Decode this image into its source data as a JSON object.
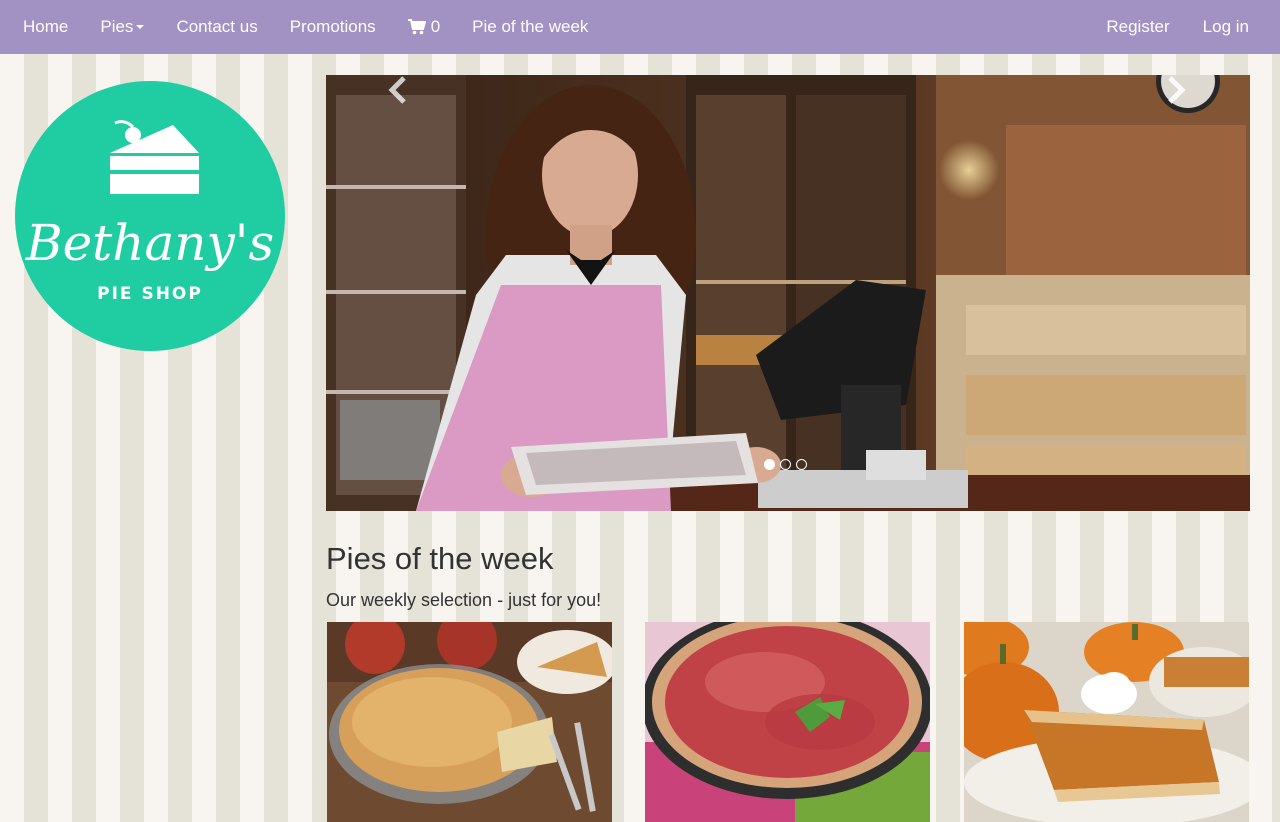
{
  "nav": {
    "home": "Home",
    "pies": "Pies",
    "contact": "Contact us",
    "promotions": "Promotions",
    "cart_count": "0",
    "pie_of_week": "Pie of the week",
    "register": "Register",
    "login": "Log in"
  },
  "logo": {
    "name": "Bethany's",
    "subtitle": "PIE SHOP"
  },
  "carousel": {
    "slide_count": 3,
    "active_index": 0
  },
  "section": {
    "title": "Pies of the week",
    "subtitle": "Our weekly selection - just for you!"
  },
  "colors": {
    "navbar": "#a291c3",
    "logo": "#20cda3",
    "stripe_light": "#f8f5f1",
    "stripe_dark": "#e5e2d7"
  },
  "icons": [
    "cart-icon",
    "chevron-left-icon",
    "chevron-right-icon",
    "cake-slice-icon"
  ]
}
